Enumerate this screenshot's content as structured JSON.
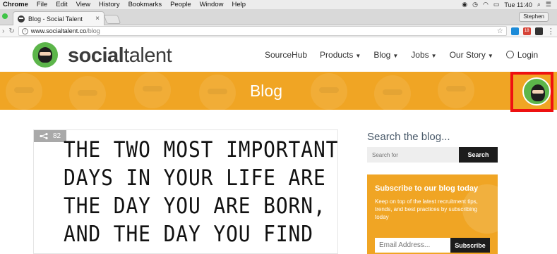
{
  "menubar": {
    "app": "Chrome",
    "items": [
      "File",
      "Edit",
      "View",
      "History",
      "Bookmarks",
      "People",
      "Window",
      "Help"
    ],
    "time": "Tue 11:40"
  },
  "browser": {
    "tab_title": "Blog - Social Talent",
    "tab_close": "×",
    "profile": "Stephen",
    "url_host": "www.socialtalent.co",
    "url_path": "/blog",
    "ext_badge": "18"
  },
  "site": {
    "logo_bold": "social",
    "logo_rest": "talent",
    "nav": {
      "sourcehub": "SourceHub",
      "products": "Products",
      "blog": "Blog",
      "jobs": "Jobs",
      "ourstory": "Our Story",
      "login": "Login"
    },
    "banner_title": "Blog"
  },
  "article": {
    "share_count": "82",
    "quote_lines": [
      "THE TWO MOST IMPORTANT",
      "DAYS IN YOUR LIFE ARE",
      "THE DAY YOU ARE BORN,",
      "AND THE DAY YOU FIND"
    ]
  },
  "sidebar": {
    "search_title": "Search the blog...",
    "search_placeholder": "Search for",
    "search_button": "Search",
    "subscribe_title": "Subscribe to our blog today",
    "subscribe_text": "Keep on top of the latest recruitment tips, trends, and best practices by subscribing today",
    "email_placeholder": "Email Address...",
    "subscribe_button": "Subscribe"
  },
  "colors": {
    "brand_orange": "#f0a524",
    "brand_green": "#5cb54a",
    "highlight_red": "#ee1111"
  }
}
